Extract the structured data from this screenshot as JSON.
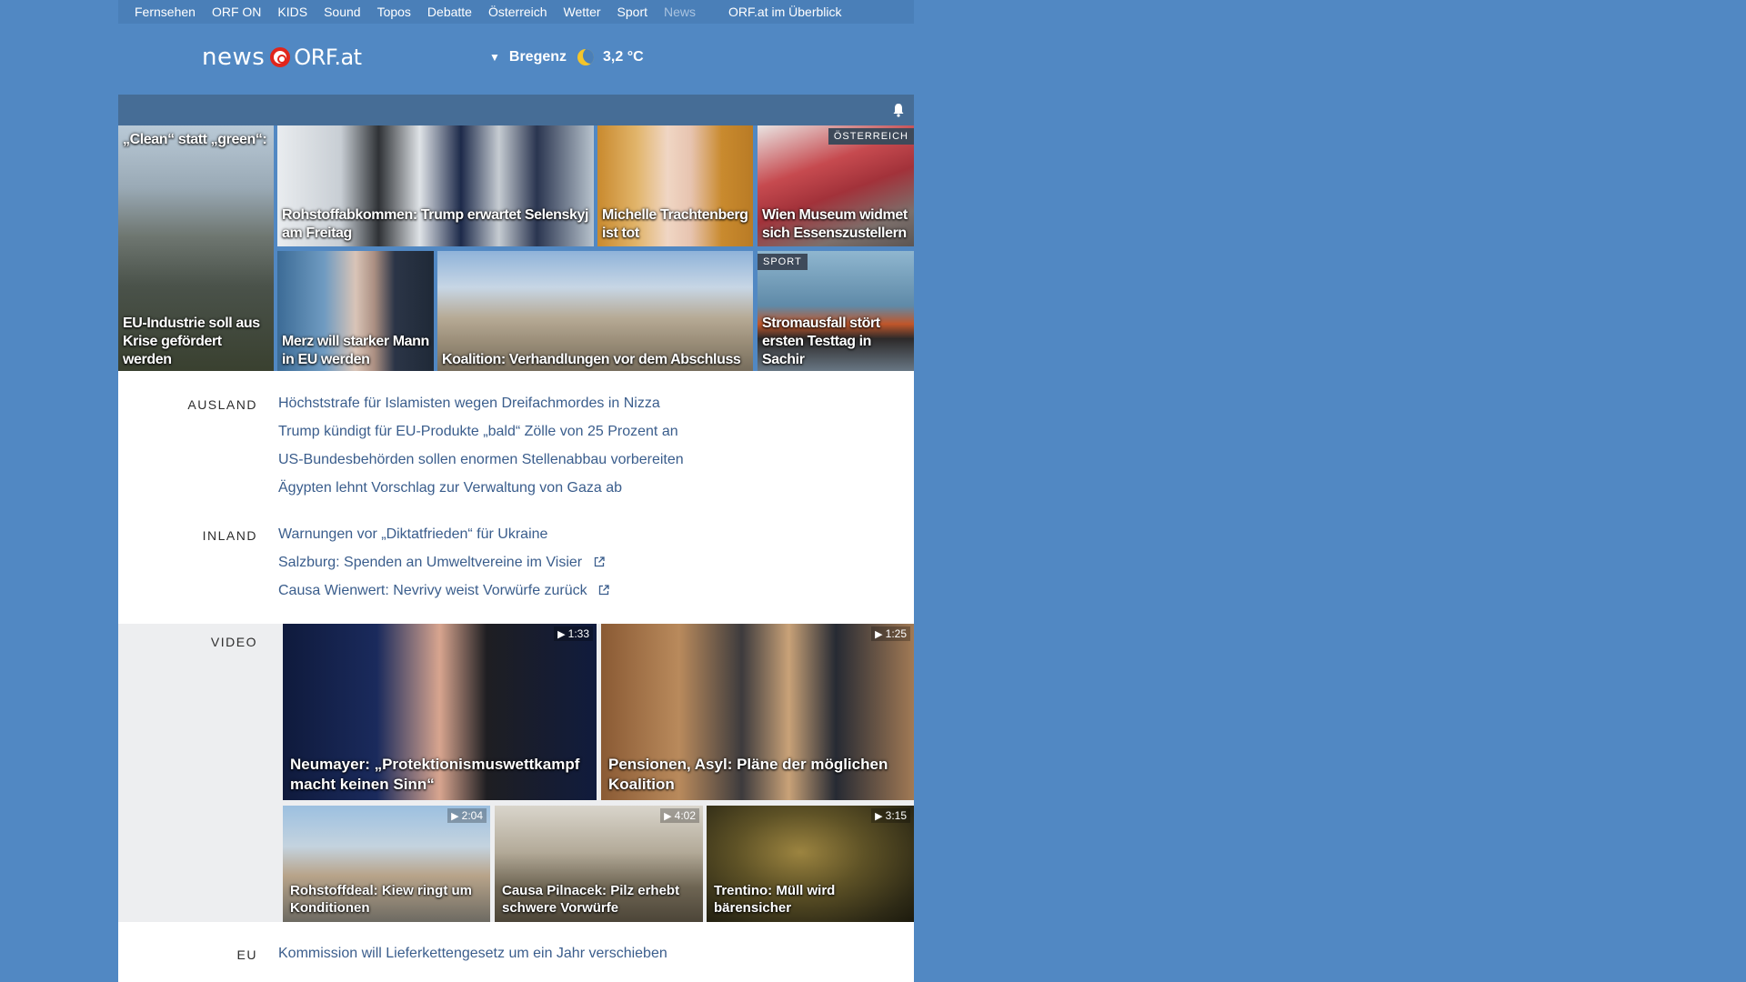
{
  "topnav": {
    "items": [
      "Fernsehen",
      "ORF ON",
      "KIDS",
      "Sound",
      "Topos",
      "Debatte",
      "Österreich",
      "Wetter",
      "Sport",
      "News"
    ],
    "overview": "ORF.at im Überblick"
  },
  "header": {
    "logo_news": "news",
    "logo_orf": "ORF.at",
    "location": "Bregenz",
    "temperature": "3,2 °C"
  },
  "grid": {
    "t0": {
      "caption_top": "„Clean“ statt „green“:",
      "caption": "EU-Industrie soll aus Krise gefördert werden"
    },
    "t1": {
      "caption": "Rohstoffabkommen: Trump erwartet Selenskyj am Freitag"
    },
    "t2": {
      "caption": "Michelle Trachtenberg ist tot"
    },
    "t3": {
      "tag": "ÖSTERREICH",
      "caption": "Wien Museum widmet sich Essenszustellern"
    },
    "t4": {
      "caption": "Merz will starker Mann in EU werden"
    },
    "t5": {
      "caption": "Koalition: Verhandlungen vor dem Abschluss"
    },
    "t6": {
      "tag": "SPORT",
      "caption": "Stromausfall stört ersten Testtag in Sachir"
    }
  },
  "sections": {
    "ausland": {
      "label": "AUSLAND",
      "items": [
        "Höchststrafe für Islamisten wegen Dreifachmordes in Nizza",
        "Trump kündigt für EU-Produkte „bald“ Zölle von 25 Prozent an",
        "US-Bundesbehörden sollen enormen Stellenabbau vorbereiten",
        "Ägypten lehnt Vorschlag zur Verwaltung von Gaza ab"
      ]
    },
    "inland": {
      "label": "INLAND",
      "items": [
        "Warnungen vor „Diktatfrieden“ für Ukraine",
        "Salzburg: Spenden an Umweltvereine im Visier",
        "Causa Wienwert: Nevrivy weist Vorwürfe zurück"
      ]
    },
    "video": {
      "label": "VIDEO",
      "items": [
        {
          "duration": "1:33",
          "caption": "Neumayer: „Protektionismuswettkampf macht keinen Sinn“"
        },
        {
          "duration": "1:25",
          "caption": "Pensionen, Asyl: Pläne der möglichen Koalition"
        },
        {
          "duration": "2:04",
          "caption": "Rohstoffdeal: Kiew ringt um Konditionen"
        },
        {
          "duration": "4:02",
          "caption": "Causa Pilnacek: Pilz erhebt schwere Vorwürfe"
        },
        {
          "duration": "3:15",
          "caption": "Trentino: Müll wird bärensicher"
        }
      ]
    },
    "eu": {
      "label": "EU",
      "items": [
        "Kommission will Lieferkettengesetz um ein Jahr verschieben"
      ]
    }
  },
  "colors": {
    "page_bg": "#5188c3",
    "nav_bg": "#4a7fb8",
    "bar_bg": "#466d96",
    "link": "#3a5d8c",
    "orf_red": "#e1251b"
  },
  "icons": [
    "bell-icon",
    "moon-icon",
    "play-icon",
    "external-link-icon",
    "dropdown-triangle-icon"
  ]
}
